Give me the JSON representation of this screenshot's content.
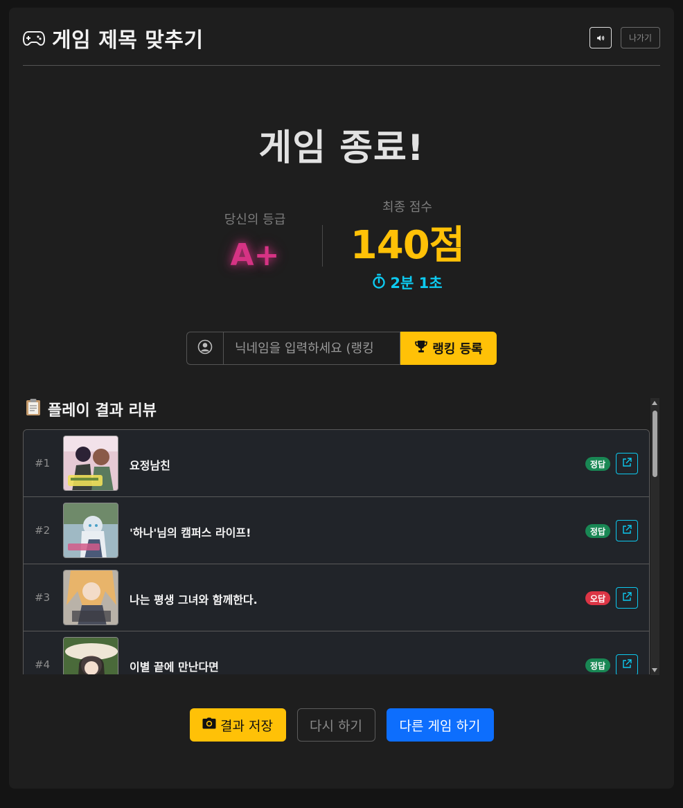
{
  "header": {
    "title": "게임 제목 맞추기",
    "title_icon": "gamepad-icon",
    "sound_icon": "speaker-icon",
    "exit_label": "나가기"
  },
  "result": {
    "title": "게임 종료!",
    "grade_label": "당신의 등급",
    "grade": "A+",
    "score_label": "최종 점수",
    "score": "140점",
    "time_icon": "stopwatch-icon",
    "time": "2분 1초"
  },
  "ranking": {
    "placeholder": "닉네임을 입력하세요 (랭킹",
    "user_icon": "user-circle-icon",
    "button_icon": "trophy-icon",
    "button_label": "랭킹 등록"
  },
  "review": {
    "title": "플레이 결과 리뷰",
    "title_icon": "clipboard-icon",
    "items": [
      {
        "num": "#1",
        "title": "요정남친",
        "status": "정답"
      },
      {
        "num": "#2",
        "title": "'하나'님의 캠퍼스 라이프!",
        "status": "정답"
      },
      {
        "num": "#3",
        "title": "나는 평생 그녀와 함께한다.",
        "status": "오답"
      },
      {
        "num": "#4",
        "title": "이별 끝에 만난다면",
        "status": "정답"
      }
    ]
  },
  "footer": {
    "save_label": "결과 저장",
    "save_icon": "camera-icon",
    "retry_label": "다시 하기",
    "other_label": "다른 게임 하기"
  },
  "colors": {
    "background": "#1e1e1e",
    "accent_yellow": "#ffc107",
    "accent_blue": "#0d6efd",
    "accent_cyan": "#0dcaf0",
    "grade_pink": "#d63384",
    "correct_green": "#198754",
    "wrong_red": "#dc3545"
  }
}
